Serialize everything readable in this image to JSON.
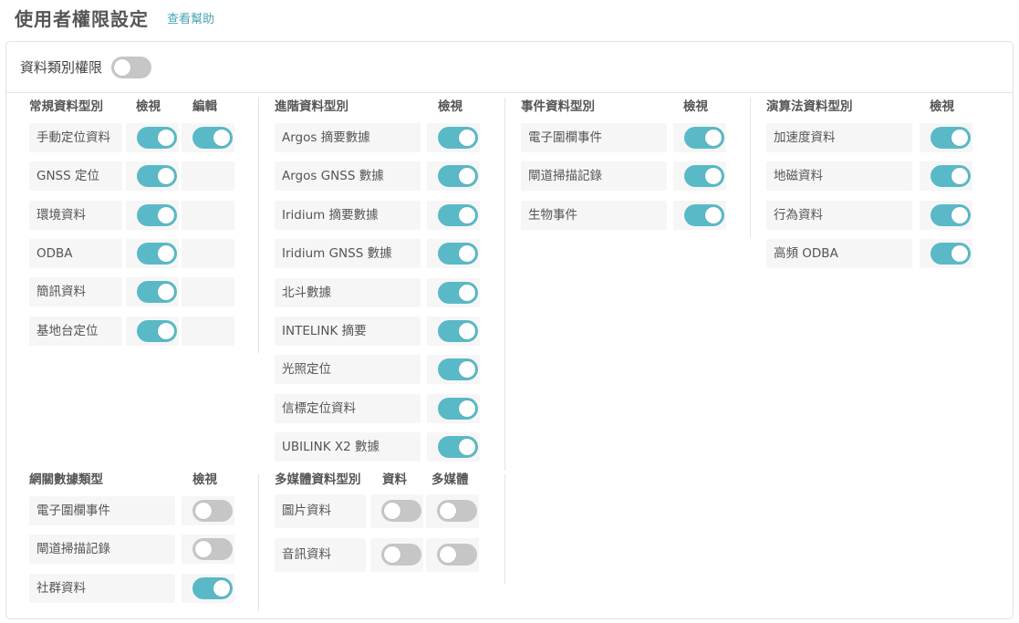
{
  "header": {
    "title": "使用者權限設定",
    "help": "查看幫助"
  },
  "panel": {
    "category_label": "資料類別權限",
    "category_toggle": false
  },
  "sections": [
    {
      "id": "regular",
      "columns": [
        "常規資料型別",
        "檢視",
        "編輯"
      ],
      "rows": [
        {
          "name": "手動定位資料",
          "toggles": [
            true,
            true
          ]
        },
        {
          "name": "GNSS 定位",
          "toggles": [
            true
          ]
        },
        {
          "name": "環境資料",
          "toggles": [
            true
          ]
        },
        {
          "name": "ODBA",
          "toggles": [
            true
          ]
        },
        {
          "name": "簡訊資料",
          "toggles": [
            true
          ]
        },
        {
          "name": "基地台定位",
          "toggles": [
            true
          ]
        }
      ]
    },
    {
      "id": "advanced",
      "columns": [
        "進階資料型別",
        "檢視"
      ],
      "rows": [
        {
          "name": "Argos 摘要數據",
          "toggles": [
            true
          ]
        },
        {
          "name": "Argos GNSS 數據",
          "toggles": [
            true
          ]
        },
        {
          "name": "Iridium 摘要數據",
          "toggles": [
            true
          ]
        },
        {
          "name": "Iridium GNSS 數據",
          "toggles": [
            true
          ]
        },
        {
          "name": "北斗數據",
          "toggles": [
            true
          ]
        },
        {
          "name": "INTELINK 摘要",
          "toggles": [
            true
          ]
        },
        {
          "name": "光照定位",
          "toggles": [
            true
          ]
        },
        {
          "name": "信標定位資料",
          "toggles": [
            true
          ]
        },
        {
          "name": "UBILINK X2 數據",
          "toggles": [
            true
          ]
        }
      ]
    },
    {
      "id": "event",
      "columns": [
        "事件資料型別",
        "檢視"
      ],
      "rows": [
        {
          "name": "電子圍欄事件",
          "toggles": [
            true
          ]
        },
        {
          "name": "閘道掃描記錄",
          "toggles": [
            true
          ]
        },
        {
          "name": "生物事件",
          "toggles": [
            true
          ]
        }
      ]
    },
    {
      "id": "algorithm",
      "columns": [
        "演算法資料型別",
        "檢視"
      ],
      "rows": [
        {
          "name": "加速度資料",
          "toggles": [
            true
          ]
        },
        {
          "name": "地磁資料",
          "toggles": [
            true
          ]
        },
        {
          "name": "行為資料",
          "toggles": [
            true
          ]
        },
        {
          "name": "高頻 ODBA",
          "toggles": [
            true
          ]
        }
      ]
    },
    {
      "id": "gateway",
      "columns": [
        "網關數據類型",
        "檢視"
      ],
      "rows": [
        {
          "name": "電子圍欄事件",
          "toggles": [
            false
          ]
        },
        {
          "name": "閘道掃描記錄",
          "toggles": [
            false
          ]
        },
        {
          "name": "社群資料",
          "toggles": [
            true
          ]
        }
      ]
    },
    {
      "id": "multimedia",
      "columns": [
        "多媒體資料型別",
        "資料",
        "多媒體"
      ],
      "rows": [
        {
          "name": "圖片資料",
          "toggles": [
            false,
            false
          ]
        },
        {
          "name": "音訊資料",
          "toggles": [
            false,
            false
          ]
        }
      ]
    }
  ]
}
